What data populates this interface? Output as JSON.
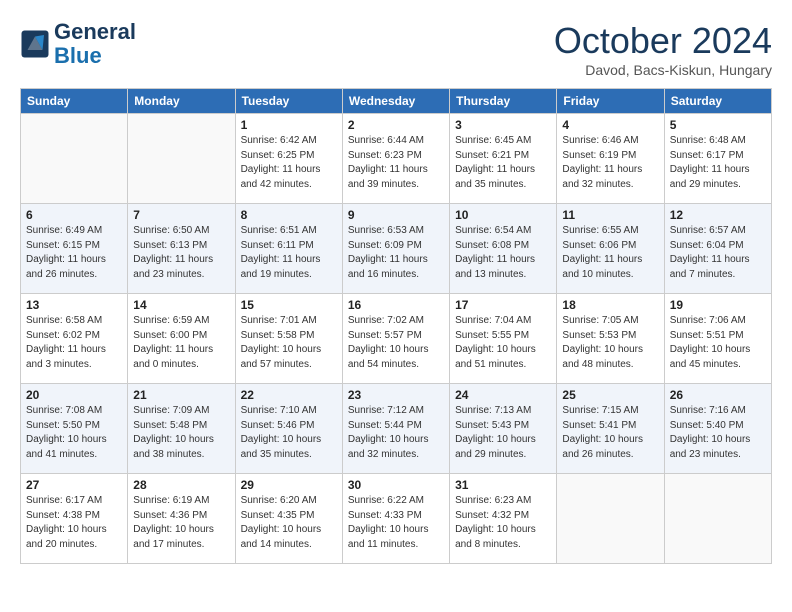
{
  "header": {
    "logo_line1": "General",
    "logo_line2": "Blue",
    "month": "October 2024",
    "location": "Davod, Bacs-Kiskun, Hungary"
  },
  "days_of_week": [
    "Sunday",
    "Monday",
    "Tuesday",
    "Wednesday",
    "Thursday",
    "Friday",
    "Saturday"
  ],
  "weeks": [
    [
      {
        "day": "",
        "info": ""
      },
      {
        "day": "",
        "info": ""
      },
      {
        "day": "1",
        "info": "Sunrise: 6:42 AM\nSunset: 6:25 PM\nDaylight: 11 hours and 42 minutes."
      },
      {
        "day": "2",
        "info": "Sunrise: 6:44 AM\nSunset: 6:23 PM\nDaylight: 11 hours and 39 minutes."
      },
      {
        "day": "3",
        "info": "Sunrise: 6:45 AM\nSunset: 6:21 PM\nDaylight: 11 hours and 35 minutes."
      },
      {
        "day": "4",
        "info": "Sunrise: 6:46 AM\nSunset: 6:19 PM\nDaylight: 11 hours and 32 minutes."
      },
      {
        "day": "5",
        "info": "Sunrise: 6:48 AM\nSunset: 6:17 PM\nDaylight: 11 hours and 29 minutes."
      }
    ],
    [
      {
        "day": "6",
        "info": "Sunrise: 6:49 AM\nSunset: 6:15 PM\nDaylight: 11 hours and 26 minutes."
      },
      {
        "day": "7",
        "info": "Sunrise: 6:50 AM\nSunset: 6:13 PM\nDaylight: 11 hours and 23 minutes."
      },
      {
        "day": "8",
        "info": "Sunrise: 6:51 AM\nSunset: 6:11 PM\nDaylight: 11 hours and 19 minutes."
      },
      {
        "day": "9",
        "info": "Sunrise: 6:53 AM\nSunset: 6:09 PM\nDaylight: 11 hours and 16 minutes."
      },
      {
        "day": "10",
        "info": "Sunrise: 6:54 AM\nSunset: 6:08 PM\nDaylight: 11 hours and 13 minutes."
      },
      {
        "day": "11",
        "info": "Sunrise: 6:55 AM\nSunset: 6:06 PM\nDaylight: 11 hours and 10 minutes."
      },
      {
        "day": "12",
        "info": "Sunrise: 6:57 AM\nSunset: 6:04 PM\nDaylight: 11 hours and 7 minutes."
      }
    ],
    [
      {
        "day": "13",
        "info": "Sunrise: 6:58 AM\nSunset: 6:02 PM\nDaylight: 11 hours and 3 minutes."
      },
      {
        "day": "14",
        "info": "Sunrise: 6:59 AM\nSunset: 6:00 PM\nDaylight: 11 hours and 0 minutes."
      },
      {
        "day": "15",
        "info": "Sunrise: 7:01 AM\nSunset: 5:58 PM\nDaylight: 10 hours and 57 minutes."
      },
      {
        "day": "16",
        "info": "Sunrise: 7:02 AM\nSunset: 5:57 PM\nDaylight: 10 hours and 54 minutes."
      },
      {
        "day": "17",
        "info": "Sunrise: 7:04 AM\nSunset: 5:55 PM\nDaylight: 10 hours and 51 minutes."
      },
      {
        "day": "18",
        "info": "Sunrise: 7:05 AM\nSunset: 5:53 PM\nDaylight: 10 hours and 48 minutes."
      },
      {
        "day": "19",
        "info": "Sunrise: 7:06 AM\nSunset: 5:51 PM\nDaylight: 10 hours and 45 minutes."
      }
    ],
    [
      {
        "day": "20",
        "info": "Sunrise: 7:08 AM\nSunset: 5:50 PM\nDaylight: 10 hours and 41 minutes."
      },
      {
        "day": "21",
        "info": "Sunrise: 7:09 AM\nSunset: 5:48 PM\nDaylight: 10 hours and 38 minutes."
      },
      {
        "day": "22",
        "info": "Sunrise: 7:10 AM\nSunset: 5:46 PM\nDaylight: 10 hours and 35 minutes."
      },
      {
        "day": "23",
        "info": "Sunrise: 7:12 AM\nSunset: 5:44 PM\nDaylight: 10 hours and 32 minutes."
      },
      {
        "day": "24",
        "info": "Sunrise: 7:13 AM\nSunset: 5:43 PM\nDaylight: 10 hours and 29 minutes."
      },
      {
        "day": "25",
        "info": "Sunrise: 7:15 AM\nSunset: 5:41 PM\nDaylight: 10 hours and 26 minutes."
      },
      {
        "day": "26",
        "info": "Sunrise: 7:16 AM\nSunset: 5:40 PM\nDaylight: 10 hours and 23 minutes."
      }
    ],
    [
      {
        "day": "27",
        "info": "Sunrise: 6:17 AM\nSunset: 4:38 PM\nDaylight: 10 hours and 20 minutes."
      },
      {
        "day": "28",
        "info": "Sunrise: 6:19 AM\nSunset: 4:36 PM\nDaylight: 10 hours and 17 minutes."
      },
      {
        "day": "29",
        "info": "Sunrise: 6:20 AM\nSunset: 4:35 PM\nDaylight: 10 hours and 14 minutes."
      },
      {
        "day": "30",
        "info": "Sunrise: 6:22 AM\nSunset: 4:33 PM\nDaylight: 10 hours and 11 minutes."
      },
      {
        "day": "31",
        "info": "Sunrise: 6:23 AM\nSunset: 4:32 PM\nDaylight: 10 hours and 8 minutes."
      },
      {
        "day": "",
        "info": ""
      },
      {
        "day": "",
        "info": ""
      }
    ]
  ]
}
